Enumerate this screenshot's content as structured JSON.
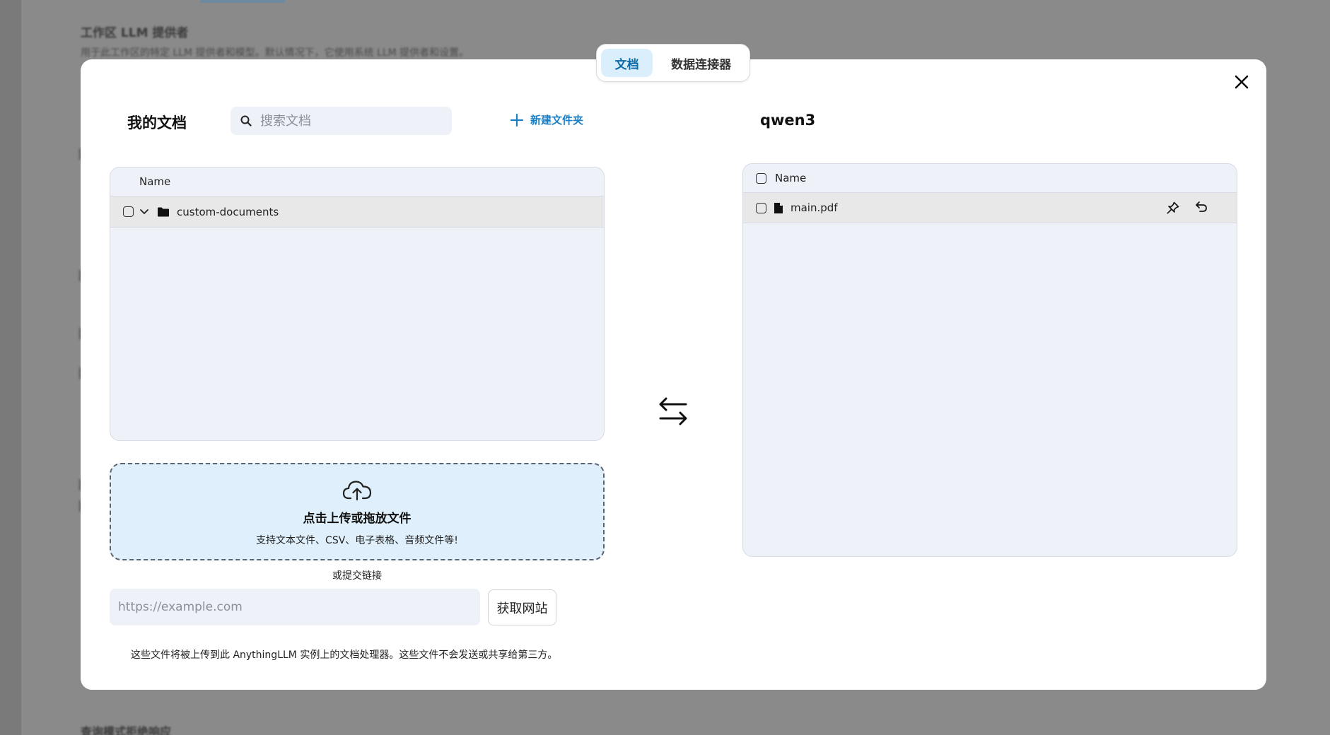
{
  "background": {
    "heading": "工作区 LLM 提供者",
    "subtext": "用于此工作区的特定 LLM 提供者和模型。默认情况下，它使用系统 LLM 提供者和设置。",
    "bottom_heading": "查询模式拒绝响应"
  },
  "tabs": [
    {
      "label": "文档",
      "active": true
    },
    {
      "label": "数据连接器",
      "active": false
    }
  ],
  "left": {
    "title": "我的文档",
    "search_placeholder": "搜索文档",
    "new_folder_label": "新建文件夹",
    "column_header": "Name",
    "rows": [
      {
        "name": "custom-documents",
        "icon": "folder-icon",
        "expanded": true
      }
    ]
  },
  "right": {
    "title": "qwen3",
    "column_header": "Name",
    "rows": [
      {
        "name": "main.pdf",
        "icon": "file-icon"
      }
    ]
  },
  "upload": {
    "title": "点击上传或拖放文件",
    "subtitle": "支持文本文件、CSV、电子表格、音频文件等!"
  },
  "link": {
    "label": "或提交链接",
    "url_placeholder": "https://example.com",
    "fetch_button": "获取网站"
  },
  "disclaimer": "这些文件将被上传到此 AnythingLLM 实例上的文档处理器。这些文件不会发送或共享给第三方。",
  "colors": {
    "accent": "#1c7fc4",
    "active_tab_bg": "#dbeefb",
    "upload_bg": "#dff0fc",
    "panel_bg": "#eef1f8"
  }
}
